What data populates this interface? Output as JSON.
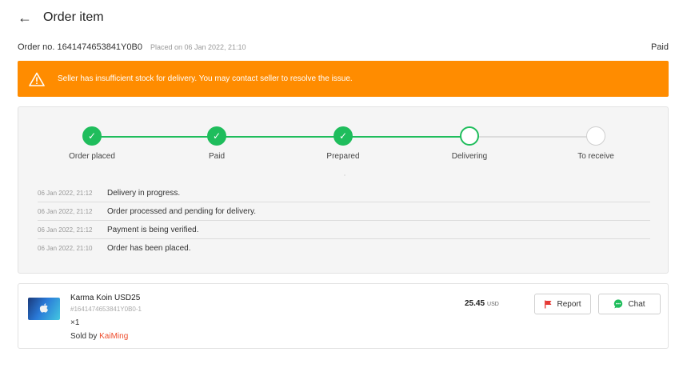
{
  "header": {
    "back_icon": "arrow-left-icon",
    "title": "Order item"
  },
  "order": {
    "number": "Order no. 1641474653841Y0B0",
    "placed_on": "Placed on 06 Jan 2022, 21:10",
    "status": "Paid"
  },
  "warning": {
    "icon": "warning-triangle-icon",
    "message": "Seller has insufficient stock for delivery. You may contact seller to resolve the issue."
  },
  "progress": {
    "accent_color": "#1fbd5c",
    "steps": [
      {
        "label": "Order placed",
        "state": "done"
      },
      {
        "label": "Paid",
        "state": "done"
      },
      {
        "label": "Prepared",
        "state": "done"
      },
      {
        "label": "Delivering",
        "state": "current"
      },
      {
        "label": "To receive",
        "state": "pending"
      }
    ]
  },
  "log": [
    {
      "time": "06 Jan 2022, 21:12",
      "text": "Delivery in progress."
    },
    {
      "time": "06 Jan 2022, 21:12",
      "text": "Order processed and pending for delivery."
    },
    {
      "time": "06 Jan 2022, 21:12",
      "text": "Payment is being verified."
    },
    {
      "time": "06 Jan 2022, 21:10",
      "text": "Order has been placed."
    }
  ],
  "item": {
    "thumb_icon": "apple-logo-icon",
    "name": "Karma Koin USD25",
    "sku": "#1641474653841Y0B0-1",
    "quantity": "×1",
    "sold_by_prefix": "Sold by ",
    "seller": "KaiMing",
    "price": "25.45",
    "currency": "USD"
  },
  "actions": {
    "report_label": "Report",
    "report_icon": "flag-icon",
    "chat_label": "Chat",
    "chat_icon": "chat-bubble-icon"
  },
  "colors": {
    "warning_bg": "#ff8c00",
    "seller_link": "#ee4d2d",
    "report_flag": "#e53935",
    "chat_icon": "#1fbd5c"
  }
}
